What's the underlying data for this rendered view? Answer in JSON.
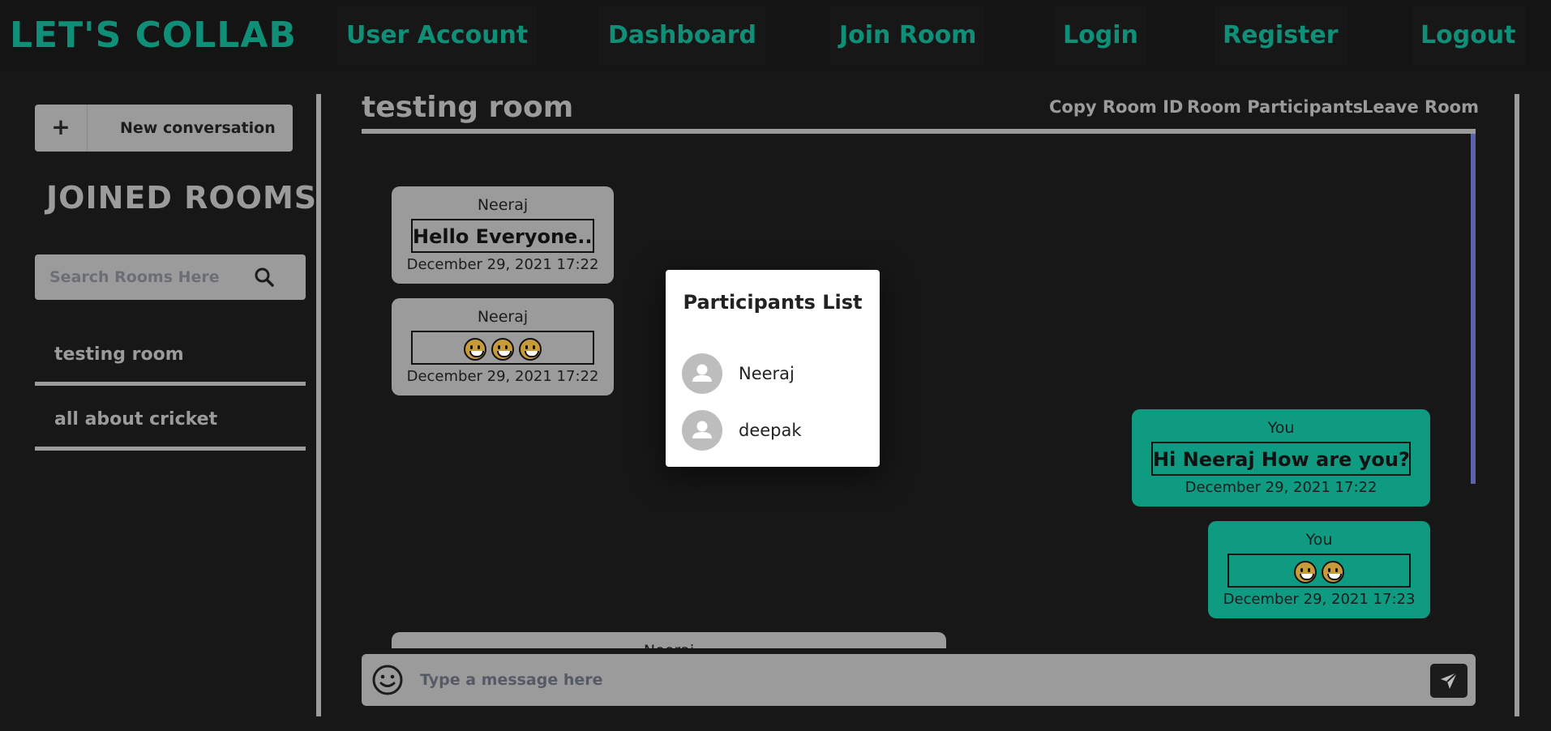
{
  "nav": {
    "brand": "LET'S COLLAB",
    "items": [
      "User Account",
      "Dashboard",
      "Join Room",
      "Login",
      "Register",
      "Logout"
    ]
  },
  "sidebar": {
    "new_conversation_icon": "+",
    "new_conversation_label": "New conversation",
    "heading": "JOINED ROOMS",
    "search_placeholder": "Search Rooms Here",
    "rooms": [
      "testing room",
      "all about cricket"
    ]
  },
  "room": {
    "title": "testing room",
    "actions": [
      "Copy Room ID",
      "Room Participants",
      "Leave Room"
    ]
  },
  "messages": [
    {
      "sender": "Neeraj",
      "body": "Hello Everyone...",
      "time": "December 29, 2021 17:22",
      "mine": false
    },
    {
      "sender": "Neeraj",
      "body": "",
      "emoji_count": 3,
      "time": "December 29, 2021 17:22",
      "mine": false
    },
    {
      "sender": "You",
      "body": "Hi Neeraj How are you??",
      "time": "December 29, 2021 17:22",
      "mine": true
    },
    {
      "sender": "You",
      "body": "",
      "emoji_count": 2,
      "time": "December 29, 2021 17:23",
      "mine": true
    },
    {
      "sender": "Neeraj",
      "body": "",
      "time": "",
      "mine": false
    }
  ],
  "composer": {
    "placeholder": "Type a message here",
    "emoji_icon": "smiley-icon",
    "send_icon": "paper-plane-icon"
  },
  "modal": {
    "title": "Participants List",
    "participants": [
      "Neeraj",
      "deepak"
    ]
  },
  "colors": {
    "background": "#171717",
    "accent": "#0f8f77",
    "muted": "#9b9b9b",
    "own_message": "#0f9a82",
    "scrollbar": "#5c63a8"
  }
}
